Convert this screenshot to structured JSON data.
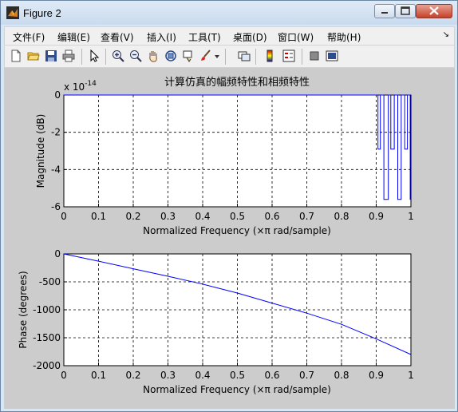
{
  "window": {
    "title": "Figure 2"
  },
  "menu": {
    "items": [
      "文件(F)",
      "编辑(E)",
      "查看(V)",
      "插入(I)",
      "工具(T)",
      "桌面(D)",
      "窗口(W)",
      "帮助(H)"
    ],
    "overflow_glyph": "↘"
  },
  "toolbar": {
    "icons": [
      "new-file-icon",
      "open-folder-icon",
      "save-icon",
      "print-icon",
      "pointer-icon",
      "zoom-in-icon",
      "zoom-out-icon",
      "pan-hand-icon",
      "rotate-3d-icon",
      "data-cursor-icon",
      "brush-icon",
      "brush-dropdown-icon",
      "link-plot-icon",
      "colorbar-icon",
      "legend-icon",
      "hide-plot-tools-icon",
      "show-plot-tools-icon"
    ]
  },
  "colors": {
    "line": "#0000ff",
    "background": "#cccccc",
    "axes_bg": "#ffffff"
  },
  "chart_data": [
    {
      "type": "line",
      "title": "计算仿真的幅频特性和相频特性",
      "xlabel": "Normalized Frequency  (×π rad/sample)",
      "ylabel": "Magnitude (dB)",
      "exponent_label": "x 10",
      "exponent_power": "-14",
      "xlim": [
        0,
        1
      ],
      "ylim": [
        -6,
        0
      ],
      "xticks": [
        "0",
        "0.1",
        "0.2",
        "0.3",
        "0.4",
        "0.5",
        "0.6",
        "0.7",
        "0.8",
        "0.9",
        "1"
      ],
      "yticks": [
        "0",
        "-2",
        "-4",
        "-6"
      ],
      "grid": true,
      "series": [
        {
          "values_description": "flat at 0 until about 0.9, then oscillating spikes",
          "x": [
            0,
            0.905,
            0.905,
            0.912,
            0.912,
            0.922,
            0.922,
            0.935,
            0.935,
            0.942,
            0.942,
            0.952,
            0.952,
            0.962,
            0.962,
            0.972,
            0.972,
            0.982,
            0.982,
            0.99,
            0.99,
            0.998,
            0.998,
            1
          ],
          "y": [
            0,
            0,
            -2.9,
            -2.9,
            0,
            0,
            -5.6,
            -5.6,
            0,
            0,
            -2.9,
            -2.9,
            0,
            0,
            -5.6,
            -5.6,
            0,
            0,
            -2.9,
            -2.9,
            0,
            0,
            -5.6,
            -5.6
          ]
        }
      ]
    },
    {
      "type": "line",
      "xlabel": "Normalized Frequency  (×π rad/sample)",
      "ylabel": "Phase (degrees)",
      "xlim": [
        0,
        1
      ],
      "ylim": [
        -2000,
        0
      ],
      "xticks": [
        "0",
        "0.1",
        "0.2",
        "0.3",
        "0.4",
        "0.5",
        "0.6",
        "0.7",
        "0.8",
        "0.9",
        "1"
      ],
      "yticks": [
        "0",
        "-500",
        "-1000",
        "-1500",
        "-2000"
      ],
      "grid": true,
      "series": [
        {
          "x": [
            0,
            0.1,
            0.2,
            0.3,
            0.4,
            0.5,
            0.6,
            0.7,
            0.8,
            0.9,
            1.0
          ],
          "y": [
            0,
            -130,
            -265,
            -400,
            -540,
            -700,
            -880,
            -1060,
            -1260,
            -1520,
            -1800
          ]
        }
      ]
    }
  ]
}
